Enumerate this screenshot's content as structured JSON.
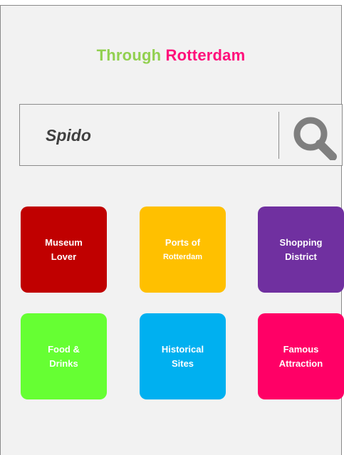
{
  "app": {
    "title_part1": "Through",
    "title_part2": "Rotterdam",
    "title_color_part1": "#92d050",
    "title_color_part2": "#ff0f7b"
  },
  "search": {
    "value": "Spido",
    "icon": "magnifier-icon"
  },
  "categories": [
    {
      "line1": "Museum",
      "line2": "Lover",
      "color": "#c00000"
    },
    {
      "line1": "Ports of",
      "line2": "Rotterdam",
      "color": "#ffc000"
    },
    {
      "line1": "Shopping",
      "line2": "District",
      "color": "#7030a0"
    },
    {
      "line1": "Food &",
      "line2": "Drinks",
      "color": "#66ff33"
    },
    {
      "line1": "Historical",
      "line2": "Sites",
      "color": "#00b0f0"
    },
    {
      "line1": "Famous",
      "line2": "Attraction",
      "color": "#ff0066"
    }
  ]
}
